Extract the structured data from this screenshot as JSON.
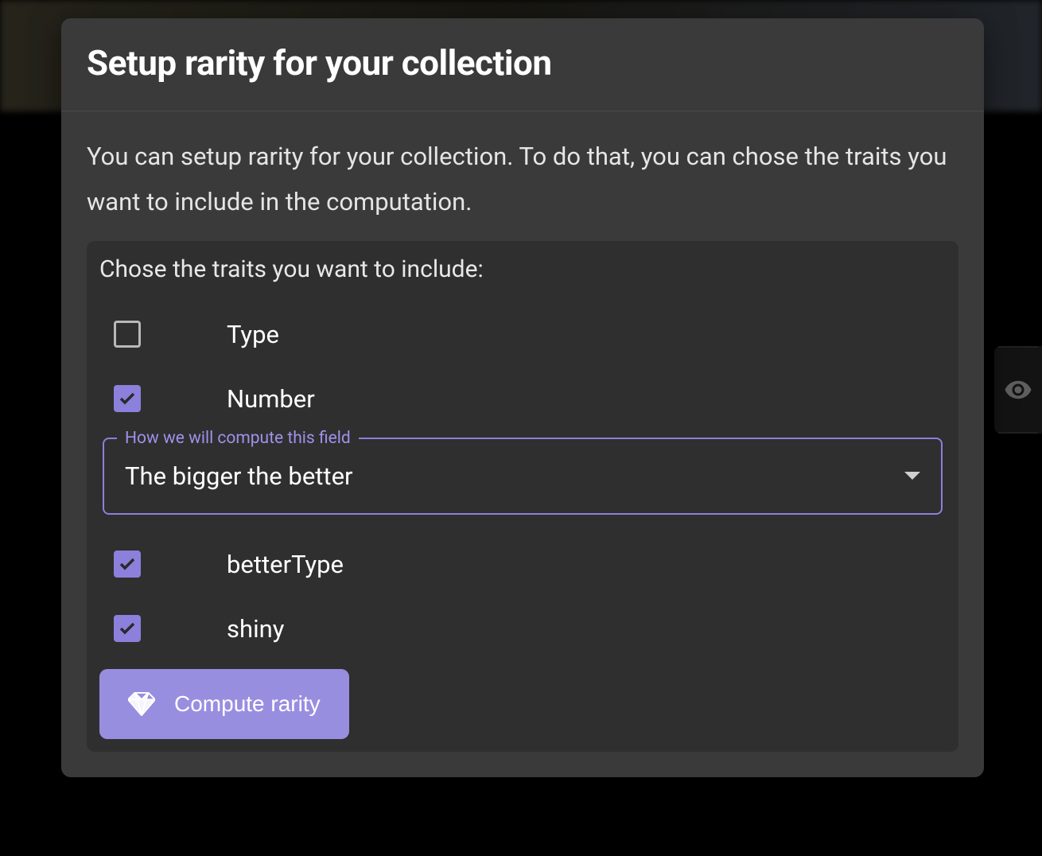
{
  "modal": {
    "title": "Setup rarity for your collection",
    "description": "You can setup rarity for your collection. To do that, you can chose the traits you want to include in the computation.",
    "traitsHeading": "Chose the traits you want to include:",
    "traits": [
      {
        "label": "Type",
        "checked": false
      },
      {
        "label": "Number",
        "checked": true
      },
      {
        "label": "betterType",
        "checked": true
      },
      {
        "label": "shiny",
        "checked": true
      }
    ],
    "select": {
      "label": "How we will compute this field",
      "value": "The bigger the better"
    },
    "computeButton": "Compute rarity"
  },
  "colors": {
    "accent": "#8b80db",
    "accentLight": "#988ee0",
    "modalBg": "#3a3a3a",
    "panelBg": "#2f2f2f"
  }
}
